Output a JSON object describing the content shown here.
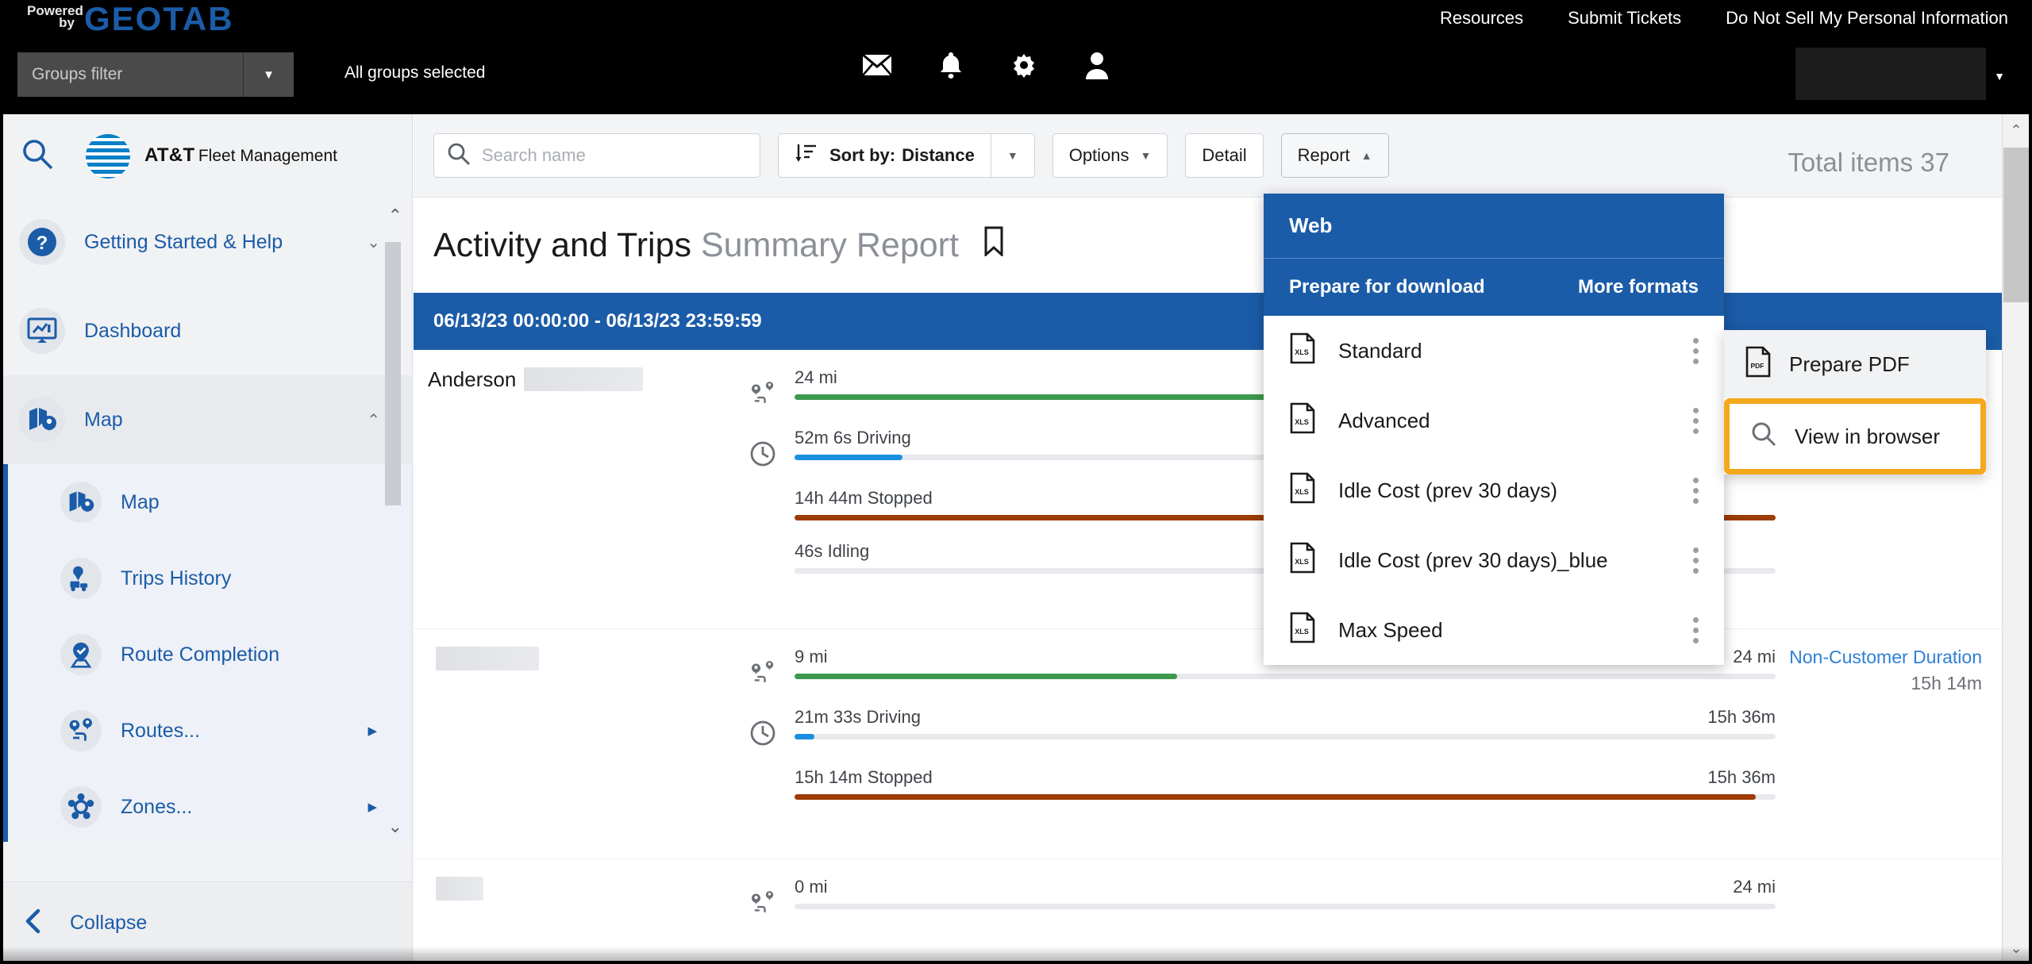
{
  "topbar": {
    "powered_by_line1": "Powered",
    "powered_by_line2": "by",
    "brand": "GEOTAB",
    "nav": [
      {
        "label": "Resources"
      },
      {
        "label": "Submit Tickets"
      },
      {
        "label": "Do Not Sell My Personal Information"
      }
    ],
    "groups_filter_placeholder": "Groups filter",
    "groups_selected_text": "All groups selected",
    "icons": [
      "mail-icon",
      "bell-icon",
      "gear-icon",
      "user-icon"
    ]
  },
  "sidebar": {
    "search_icon": "search-icon",
    "brand_line1": "AT&T",
    "brand_line2": "Fleet Management",
    "items": [
      {
        "label": "Getting Started & Help",
        "icon": "help-icon",
        "chevron": "chevron-down",
        "level": 0
      },
      {
        "label": "Dashboard",
        "icon": "dashboard-icon",
        "chevron": "",
        "level": 0
      },
      {
        "label": "Map",
        "icon": "map-icon",
        "chevron": "chevron-up",
        "level": 0
      },
      {
        "label": "Map",
        "icon": "map-icon",
        "chevron": "",
        "level": 1
      },
      {
        "label": "Trips History",
        "icon": "trips-history-icon",
        "chevron": "",
        "level": 1
      },
      {
        "label": "Route Completion",
        "icon": "route-completion-icon",
        "chevron": "",
        "level": 1
      },
      {
        "label": "Routes...",
        "icon": "routes-icon",
        "chevron": "arrow-right",
        "level": 1
      },
      {
        "label": "Zones...",
        "icon": "zones-icon",
        "chevron": "arrow-right",
        "level": 1
      }
    ],
    "collapse_label": "Collapse",
    "collapse_icon": "chevron-left-icon"
  },
  "toolbar": {
    "search_placeholder": "Search name",
    "search_value": "",
    "sort_label": "Sort by:",
    "sort_value": "Distance",
    "options_label": "Options",
    "detail_label": "Detail",
    "report_label": "Report"
  },
  "report": {
    "title_primary": "Activity and Trips",
    "title_secondary": "Summary Report",
    "bookmark_icon": "bookmark-icon",
    "total_items": "Total items 37",
    "date_range": "06/13/23 00:00:00 - 06/13/23 23:59:59"
  },
  "dropdown": {
    "web_label": "Web",
    "prepare_label": "Prepare for download",
    "more_formats_label": "More formats",
    "items": [
      {
        "label": "Standard",
        "icon": "xls-file-icon"
      },
      {
        "label": "Advanced",
        "icon": "xls-file-icon"
      },
      {
        "label": "Idle Cost (prev 30 days)",
        "icon": "xls-file-icon"
      },
      {
        "label": "Idle Cost (prev 30 days)_blue",
        "icon": "xls-file-icon"
      },
      {
        "label": "Max Speed",
        "icon": "xls-file-icon"
      }
    ]
  },
  "panel2": {
    "items": [
      {
        "label": "Prepare PDF",
        "icon": "pdf-file-icon",
        "highlighted": false
      },
      {
        "label": "View in browser",
        "icon": "search-icon",
        "highlighted": true
      }
    ],
    "highlight_color": "#f5a81c"
  },
  "colors": {
    "brand_blue": "#1b5ca8",
    "distance_bar": "#3c9a4e",
    "driving_bar": "#1a8fe0",
    "stopped_bar": "#9c3c06",
    "idling_bar": "#e7e9ec",
    "highlight": "#f5a81c"
  },
  "rows": [
    {
      "name": "Anderson",
      "name_redacted_width": 150,
      "metrics": [
        {
          "icon": "route-pin-icon",
          "label": "24 mi",
          "right": "",
          "pct": 100,
          "color": "#3c9a4e"
        },
        {
          "icon": "clock-icon",
          "label": "52m 6s Driving",
          "right": "",
          "pct": 11,
          "color": "#1a8fe0"
        },
        {
          "icon": "",
          "label": "14h 44m Stopped",
          "right": "",
          "pct": 100,
          "color": "#9c3c06"
        },
        {
          "icon": "",
          "label": "46s Idling",
          "right": "",
          "pct": 0,
          "color": "#e7e9ec"
        }
      ],
      "right_title": "",
      "right_value": ""
    },
    {
      "name": "",
      "name_redacted_width": 130,
      "metrics": [
        {
          "icon": "route-pin-icon",
          "label": "9 mi",
          "right": "24 mi",
          "pct": 39,
          "color": "#3c9a4e"
        },
        {
          "icon": "clock-icon",
          "label": "21m 33s Driving",
          "right": "15h 36m",
          "pct": 2,
          "color": "#1a8fe0"
        },
        {
          "icon": "",
          "label": "15h 14m Stopped",
          "right": "15h 36m",
          "pct": 98,
          "color": "#9c3c06"
        }
      ],
      "right_title": "Non-Customer Duration",
      "right_value": "15h 14m"
    },
    {
      "name": "",
      "name_redacted_width": 60,
      "metrics": [
        {
          "icon": "route-pin-icon",
          "label": "0 mi",
          "right": "24 mi",
          "pct": 0,
          "color": "#3c9a4e"
        }
      ],
      "right_title": "",
      "right_value": ""
    }
  ]
}
